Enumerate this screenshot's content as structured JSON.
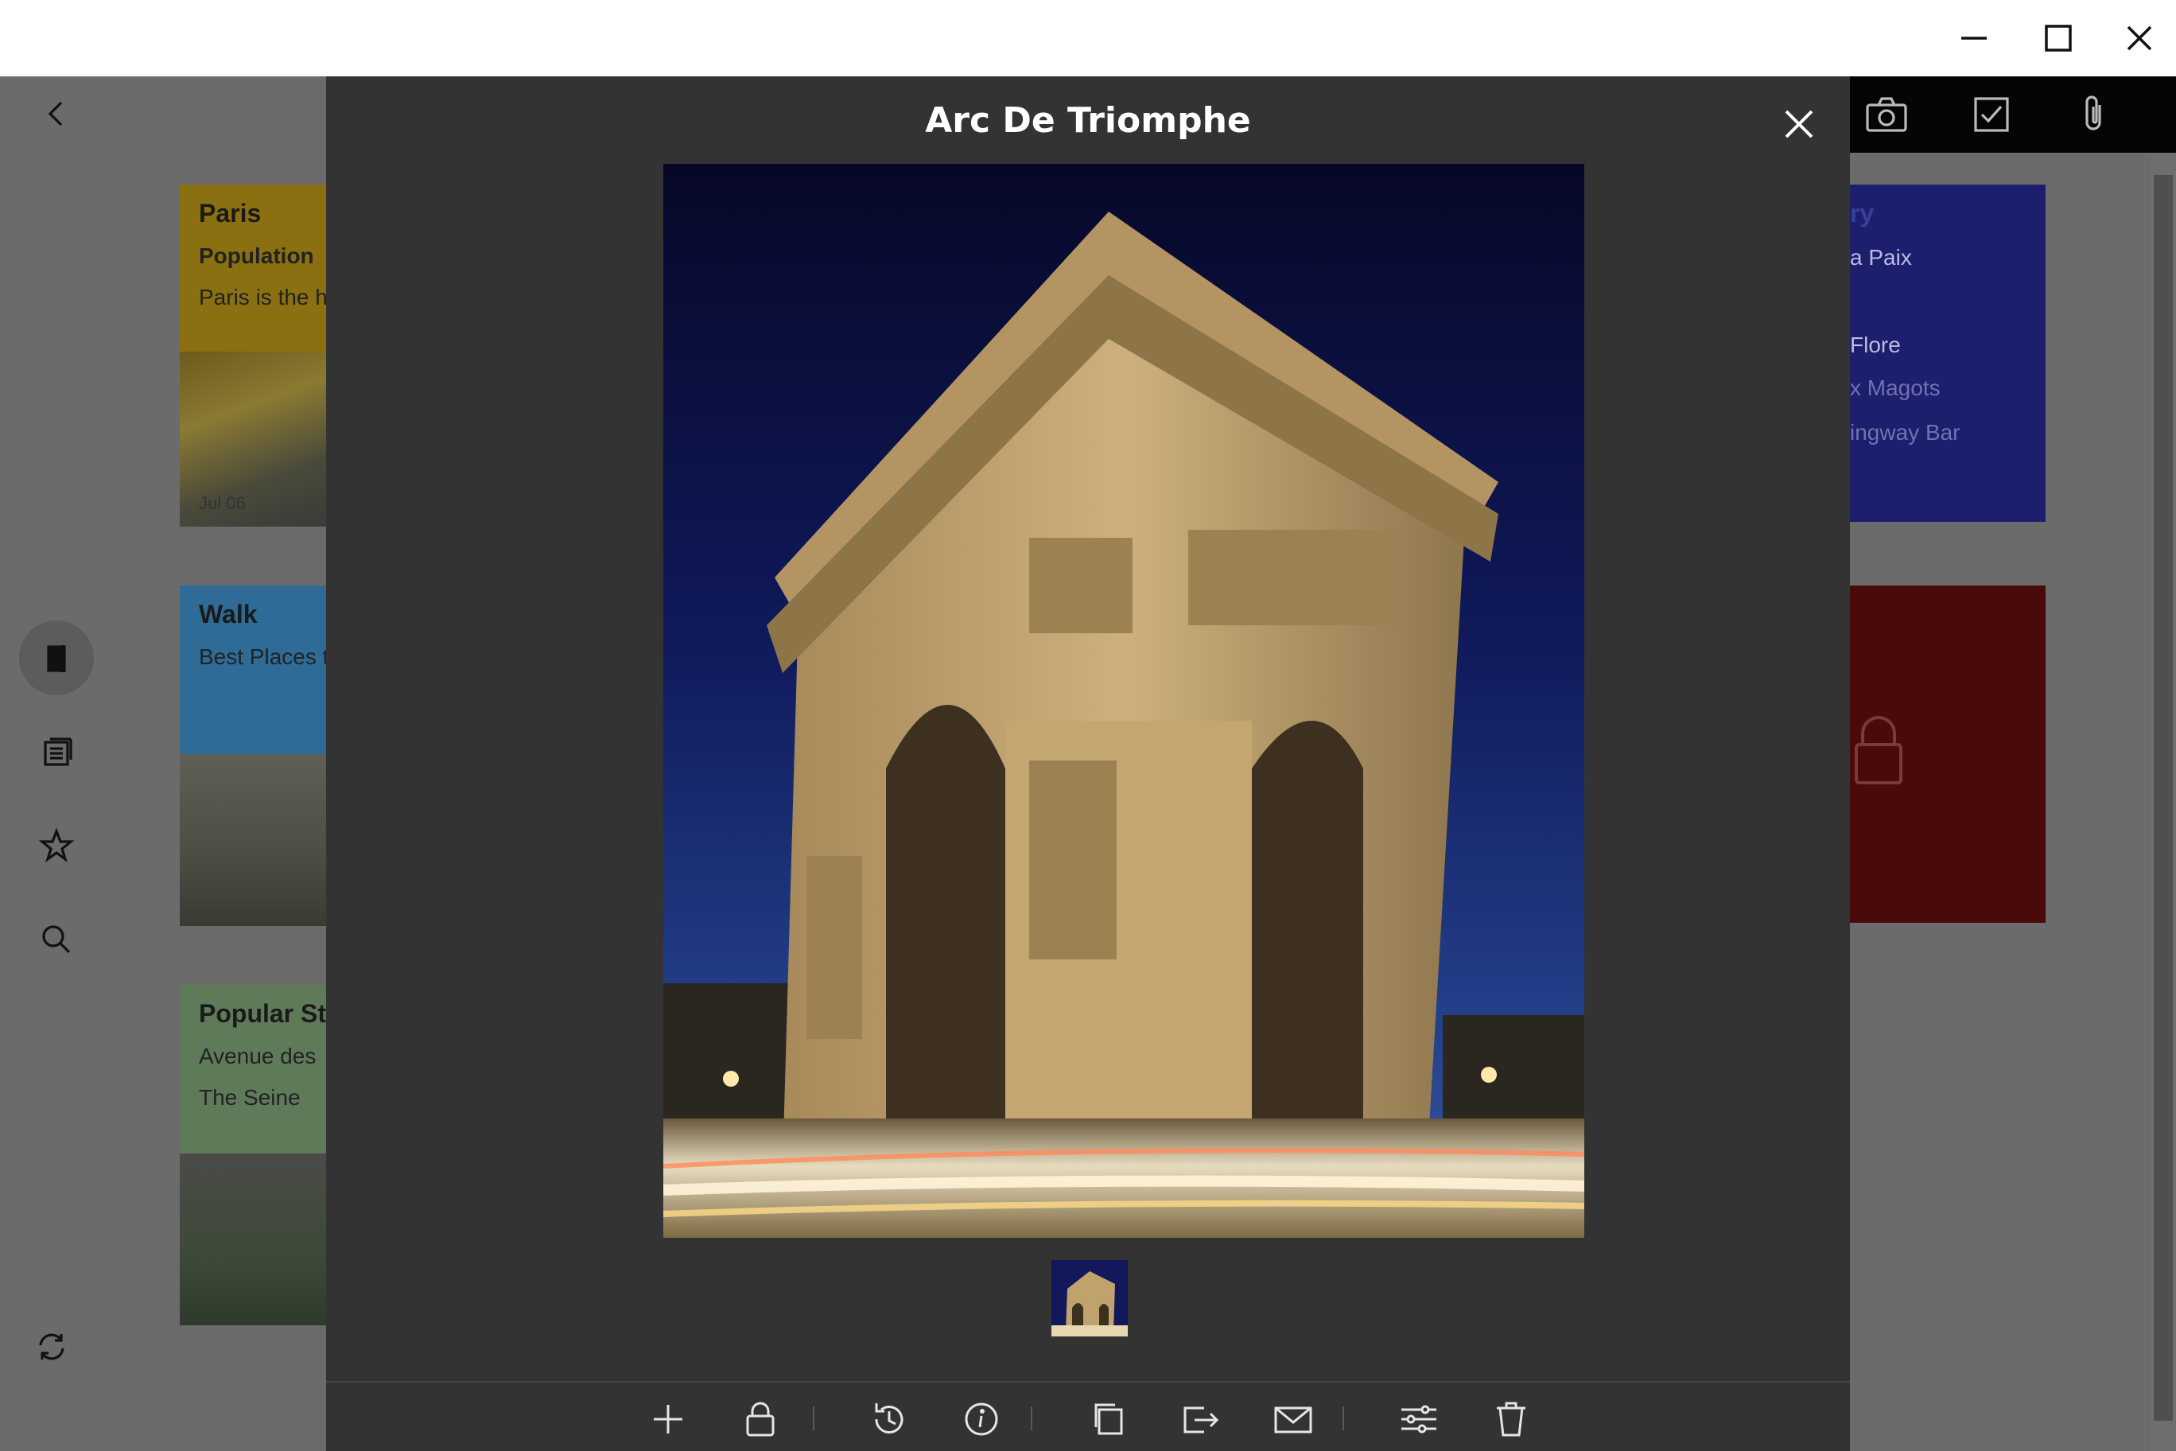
{
  "window": {
    "minimize_label": "minimize",
    "maximize_label": "maximize",
    "close_label": "close"
  },
  "notes": [
    {
      "title": "Paris",
      "line1": "Population",
      "line2": "Paris is the h",
      "date": "Jul 06",
      "color": "#8a7010"
    },
    {
      "title": "Walk",
      "line1": "Best Places t",
      "color": "#2e6b96"
    },
    {
      "title": "Popular St",
      "line1": "Avenue des",
      "line2": "The Seine",
      "color": "#5f7a59"
    },
    {
      "title": "ry",
      "line1": "a Paix",
      "line2": "Flore",
      "line3": "x Magots",
      "line4": "ingway Bar",
      "color": "#1c1f6e"
    },
    {
      "title": "",
      "color": "#4a0a0a"
    }
  ],
  "viewer": {
    "title": "Arc De Triomphe",
    "image_subject": "Arc de Triomphe at night with light trails"
  },
  "icons": {
    "rail": [
      "back-icon",
      "notebook-icon",
      "notes-icon",
      "star-icon",
      "search-icon",
      "sync-icon"
    ],
    "top": [
      "camera-icon",
      "checklist-icon",
      "attachment-icon"
    ],
    "toolbar": [
      "add-icon",
      "lock-icon",
      "history-icon",
      "info-icon",
      "copy-icon",
      "share-icon",
      "email-icon",
      "adjust-icon",
      "trash-icon"
    ]
  },
  "colors": {
    "modal_bg": "#333333",
    "app_dim_bg": "#6b6b6b",
    "title_text": "#ffffff"
  }
}
